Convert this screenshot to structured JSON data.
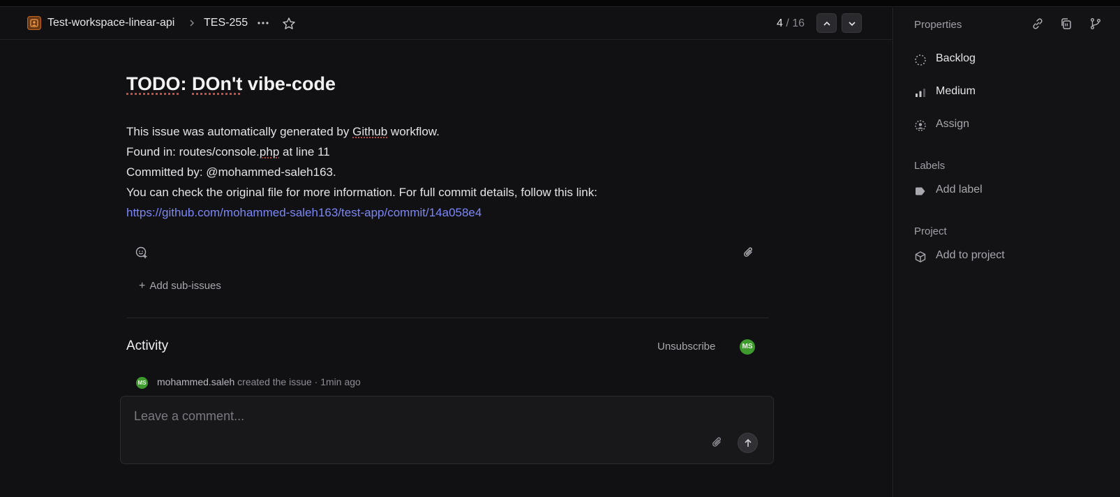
{
  "header": {
    "workspace": "Test-workspace-linear-api",
    "issue_id": "TES-255",
    "pager_current": "4",
    "pager_total": "/ 16"
  },
  "issue": {
    "title_a": "TODO",
    "title_b": ": ",
    "title_c": "DOn't",
    "title_d": " vibe-code",
    "line1_a": "This issue was automatically generated by ",
    "line1_b": "Github",
    "line1_c": " workflow.",
    "line2_a": "Found in: routes/console.",
    "line2_b": "php",
    "line2_c": " at line 11",
    "line3": "Committed by: @mohammed-saleh163.",
    "line4": "You can check the original file for more information. For full commit details, follow this link:",
    "link": "https://github.com/mohammed-saleh163/test-app/commit/14a058e4",
    "add_sub_issues": "Add sub-issues"
  },
  "activity": {
    "title": "Activity",
    "unsubscribe": "Unsubscribe",
    "avatar_initials": "MS",
    "entry_user": "mohammed.saleh",
    "entry_text": " created the issue · 1min ago",
    "comment_placeholder": "Leave a comment..."
  },
  "sidebar": {
    "properties": "Properties",
    "status": "Backlog",
    "priority": "Medium",
    "assignee": "Assign",
    "labels_heading": "Labels",
    "add_label": "Add label",
    "project_heading": "Project",
    "add_project": "Add to project"
  },
  "colors": {
    "link": "#7b87f7",
    "avatar": "#3e9a2c",
    "workspace_icon": "#c2661f"
  },
  "icons": [
    "workspace-icon",
    "chevron-right-icon",
    "more-icon",
    "star-icon",
    "chevron-up-icon",
    "chevron-down-icon",
    "emoji-icon",
    "paperclip-icon",
    "link-icon",
    "copy-id-icon",
    "branch-icon",
    "backlog-status-icon",
    "priority-medium-icon",
    "assign-user-icon",
    "label-tag-icon",
    "project-cube-icon",
    "send-arrow-icon"
  ]
}
